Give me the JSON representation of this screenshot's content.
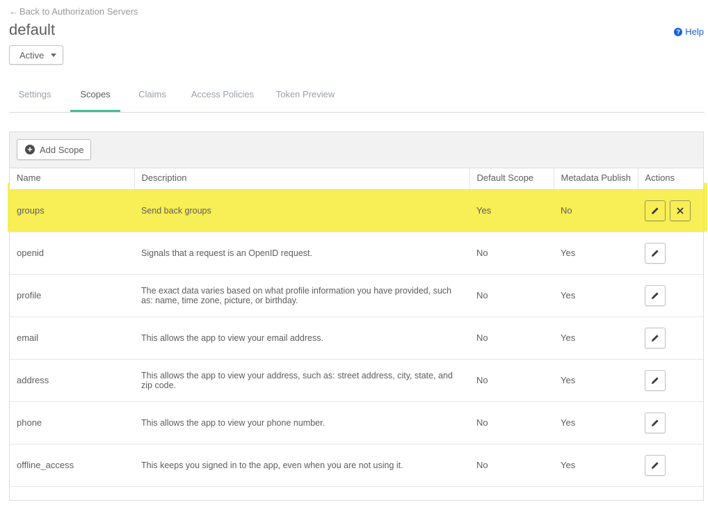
{
  "nav": {
    "back_label": "Back to Authorization Servers",
    "back_arrow": "←"
  },
  "page": {
    "title": "default",
    "help_label": "Help",
    "help_icon_glyph": "?"
  },
  "status": {
    "selected": "Active"
  },
  "tabs": [
    {
      "label": "Settings",
      "active": false
    },
    {
      "label": "Scopes",
      "active": true
    },
    {
      "label": "Claims",
      "active": false
    },
    {
      "label": "Access Policies",
      "active": false
    },
    {
      "label": "Token Preview",
      "active": false
    }
  ],
  "toolbar": {
    "add_label": "Add Scope",
    "add_icon_glyph": "+"
  },
  "table": {
    "headers": {
      "name": "Name",
      "description": "Description",
      "default": "Default Scope",
      "metadata": "Metadata Publish",
      "actions": "Actions"
    },
    "rows": [
      {
        "name": "groups",
        "description": "Send back groups",
        "default": "Yes",
        "metadata": "No",
        "deletable": true,
        "highlighted": true
      },
      {
        "name": "openid",
        "description": "Signals that a request is an OpenID request.",
        "default": "No",
        "metadata": "Yes",
        "deletable": false,
        "highlighted": false
      },
      {
        "name": "profile",
        "description": "The exact data varies based on what profile information you have provided, such as: name, time zone, picture, or birthday.",
        "default": "No",
        "metadata": "Yes",
        "deletable": false,
        "highlighted": false
      },
      {
        "name": "email",
        "description": "This allows the app to view your email address.",
        "default": "No",
        "metadata": "Yes",
        "deletable": false,
        "highlighted": false
      },
      {
        "name": "address",
        "description": "This allows the app to view your address, such as: street address, city, state, and zip code.",
        "default": "No",
        "metadata": "Yes",
        "deletable": false,
        "highlighted": false
      },
      {
        "name": "phone",
        "description": "This allows the app to view your phone number.",
        "default": "No",
        "metadata": "Yes",
        "deletable": false,
        "highlighted": false
      },
      {
        "name": "offline_access",
        "description": "This keeps you signed in to the app, even when you are not using it.",
        "default": "No",
        "metadata": "Yes",
        "deletable": false,
        "highlighted": false
      }
    ]
  },
  "colors": {
    "accent_tab": "#41c191",
    "highlight": "#f8ee55",
    "link": "#1662dd"
  }
}
